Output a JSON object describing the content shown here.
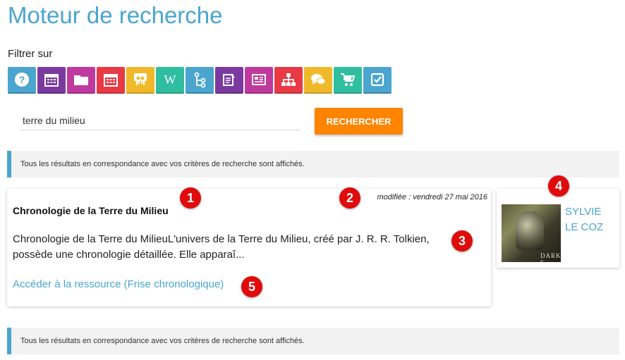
{
  "page": {
    "title": "Moteur de recherche",
    "filter_label": "Filtrer sur"
  },
  "filters": [
    {
      "name": "question-icon",
      "color": "#4aa5cf"
    },
    {
      "name": "calendar-icon",
      "color": "#7b3aa0"
    },
    {
      "name": "folder-icon",
      "color": "#c0399e"
    },
    {
      "name": "agenda-icon",
      "color": "#e83a45"
    },
    {
      "name": "slideshare-icon",
      "color": "#f0b92a"
    },
    {
      "name": "wikipedia-icon",
      "color": "#2fbe9f"
    },
    {
      "name": "mindmap-icon",
      "color": "#4aa5cf"
    },
    {
      "name": "survey-icon",
      "color": "#7b3aa0"
    },
    {
      "name": "newspaper-icon",
      "color": "#c0399e"
    },
    {
      "name": "sitemap-icon",
      "color": "#e83a45"
    },
    {
      "name": "chat-icon",
      "color": "#f0b92a"
    },
    {
      "name": "cart-icon",
      "color": "#2fbe9f"
    },
    {
      "name": "checkbox-icon",
      "color": "#4aa5cf"
    }
  ],
  "search": {
    "value": "terre du milieu",
    "button_label": "RECHERCHER"
  },
  "info_messages": {
    "top": "Tous les résultats en correspondance avec vos critères de recherche sont affichés.",
    "bottom": "Tous les résultats en correspondance avec vos critères de recherche sont affichés."
  },
  "result": {
    "title": "Chronologie de la Terre du Milieu",
    "date": "modifiée : vendredi 27 mai 2016",
    "description": "Chronologie de la Terre du MilieuL'univers de la Terre du Milieu, créé par J. R. R. Tolkien, possède une chronologie détaillée. Elle apparaî...",
    "link": "Accéder à la ressource (Frise chronologique)"
  },
  "author": {
    "name": "SYLVIE LE COZ",
    "thumb_text": "DARK S"
  },
  "badges": [
    "1",
    "2",
    "3",
    "4",
    "5"
  ],
  "colors": {
    "accent": "#4aa5cf",
    "button": "#ff8400",
    "badge": "#e00b0b"
  }
}
